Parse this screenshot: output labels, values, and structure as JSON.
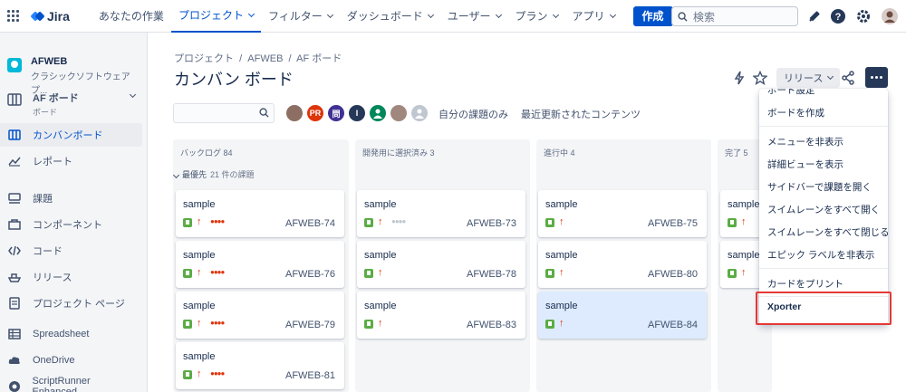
{
  "topnav": {
    "app_name": "Jira",
    "items": [
      {
        "label": "あなたの作業",
        "dropdown": false,
        "active": false
      },
      {
        "label": "プロジェクト",
        "dropdown": true,
        "active": true
      },
      {
        "label": "フィルター",
        "dropdown": true,
        "active": false
      },
      {
        "label": "ダッシュボード",
        "dropdown": true,
        "active": false
      },
      {
        "label": "ユーザー",
        "dropdown": true,
        "active": false
      },
      {
        "label": "プラン",
        "dropdown": true,
        "active": false
      },
      {
        "label": "アプリ",
        "dropdown": true,
        "active": false
      }
    ],
    "create_label": "作成",
    "search_placeholder": "検索"
  },
  "sidebar": {
    "project_name": "AFWEB",
    "project_type": "クラシックソフトウェアプ...",
    "board_name": "AF ボード",
    "board_sub": "ボード",
    "items": [
      {
        "label": "カンバンボード",
        "icon": "board-icon",
        "active": true
      },
      {
        "label": "レポート",
        "icon": "chart-icon",
        "active": false
      },
      {
        "label": "課題",
        "icon": "issues-icon",
        "active": false
      },
      {
        "label": "コンポーネント",
        "icon": "component-icon",
        "active": false
      },
      {
        "label": "コード",
        "icon": "code-icon",
        "active": false
      },
      {
        "label": "リリース",
        "icon": "ship-icon",
        "active": false
      },
      {
        "label": "プロジェクト ページ",
        "icon": "page-icon",
        "active": false
      },
      {
        "label": "Spreadsheet",
        "icon": "table-icon",
        "active": false
      },
      {
        "label": "OneDrive",
        "icon": "cloud-icon",
        "active": false
      },
      {
        "label": "ScriptRunner Enhanced...",
        "icon": "scriptrunner-icon",
        "active": false
      }
    ]
  },
  "main": {
    "breadcrumb": [
      "プロジェクト",
      "AFWEB",
      "AF ボード"
    ],
    "title": "カンバン ボード",
    "release_label": "リリース",
    "filters": [
      "自分の課題のみ",
      "最近更新されたコンテンツ"
    ],
    "avatars": [
      {
        "initials": "",
        "color": "#8d6e63"
      },
      {
        "initials": "PR",
        "color": "#de350b"
      },
      {
        "initials": "問",
        "color": "#403294"
      },
      {
        "initials": "I",
        "color": "#253858"
      },
      {
        "initials": "",
        "color": "#00875a"
      },
      {
        "initials": "",
        "color": "#a1887f"
      },
      {
        "initials": "",
        "color": "#c1c7d0"
      }
    ],
    "swimlane": {
      "label": "最優先",
      "count": "21 件の課題"
    }
  },
  "columns": [
    {
      "title": "バックログ 84",
      "cards": [
        {
          "summary": "sample",
          "key": "AFWEB-74",
          "dots": "●●●●"
        },
        {
          "summary": "sample",
          "key": "AFWEB-76",
          "dots": "●●●●"
        },
        {
          "summary": "sample",
          "key": "AFWEB-79",
          "dots": "●●●●"
        },
        {
          "summary": "sample",
          "key": "AFWEB-81",
          "dots": "●●●●"
        }
      ]
    },
    {
      "title": "開発用に選択済み 3",
      "cards": [
        {
          "summary": "sample",
          "key": "AFWEB-73",
          "dots": "●●●●"
        },
        {
          "summary": "sample",
          "key": "AFWEB-78",
          "dots": ""
        },
        {
          "summary": "sample",
          "key": "AFWEB-83",
          "dots": ""
        }
      ]
    },
    {
      "title": "進行中 4",
      "cards": [
        {
          "summary": "sample",
          "key": "AFWEB-75",
          "dots": ""
        },
        {
          "summary": "sample",
          "key": "AFWEB-80",
          "dots": ""
        },
        {
          "summary": "sample",
          "key": "AFWEB-84",
          "dots": "",
          "selected": true
        }
      ]
    },
    {
      "title": "完了 5",
      "cards": [
        {
          "summary": "sample",
          "key": "",
          "dots": ""
        },
        {
          "summary": "sample",
          "key": "",
          "dots": ""
        }
      ]
    }
  ],
  "menu": {
    "items": [
      "ボード設定",
      "ボードを作成",
      "メニューを非表示",
      "詳細ビューを表示",
      "サイドバーで課題を開く",
      "スイムレーンをすべて開く",
      "スイムレーンをすべて閉じる",
      "エピック ラベルを非表示",
      "カードをプリント",
      "Xporter"
    ]
  },
  "colors": {
    "accent": "#0052cc",
    "highlight": "#e53935",
    "story": "#5aac44",
    "priority": "#de350b"
  }
}
